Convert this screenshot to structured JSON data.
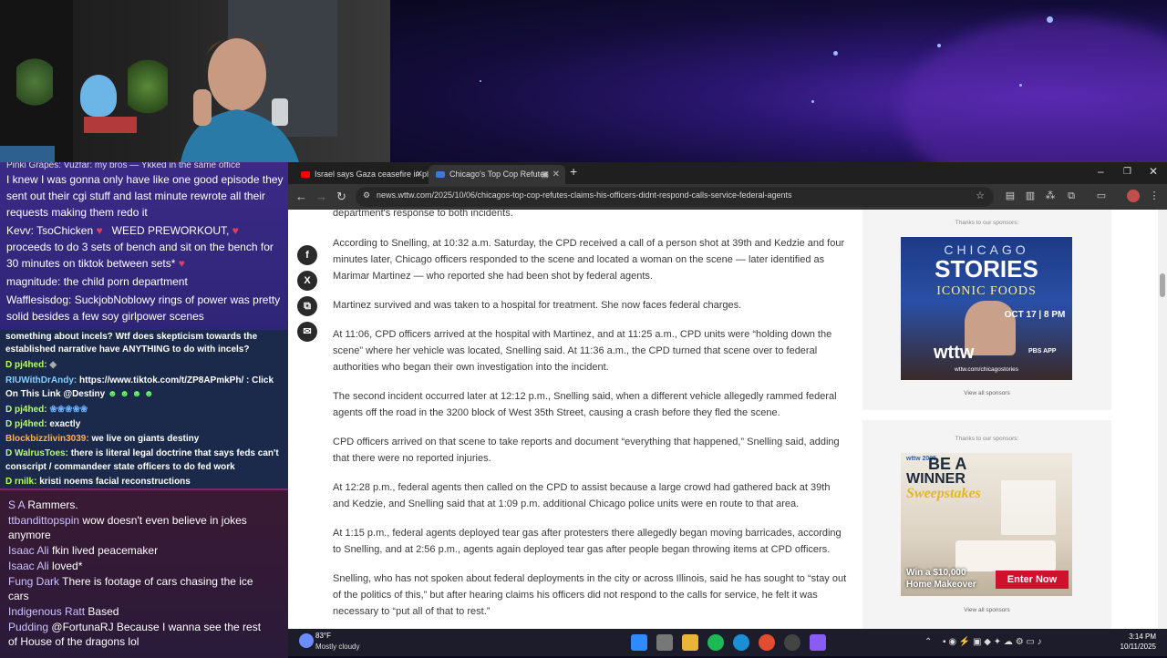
{
  "chat_top": {
    "lines": [
      {
        "text": "I knew I was gonna only have like one good episode they"
      },
      {
        "text": "sent out their cgi stuff and last minute rewrote all their"
      },
      {
        "text": "requests making them redo it"
      },
      {
        "user": "Kevv: TsoChicken",
        "text": "WEED PREWORKOUT,"
      },
      {
        "text": "proceeds to do 3 sets of bench and sit on the bench for"
      },
      {
        "text": "30 minutes on tiktok between sets*"
      },
      {
        "user": "magnitude:",
        "text": "the child porn department"
      },
      {
        "user": "Wafflesisdog:",
        "text": "SuckjobNoblowy rings of power was pretty"
      },
      {
        "text": "solid besides a few soy girlpower scenes"
      }
    ]
  },
  "chat_mid": {
    "lines": [
      {
        "text": "something about incels? Wtf does skepticism towards the"
      },
      {
        "text": "established narrative have ANYTHING to do with incels?"
      },
      {
        "user": "D pj4hed:",
        "text": ""
      },
      {
        "user": "RIUWithDrAndy:",
        "text": "https://www.tiktok.com/t/ZP8APmkPh/ : Click"
      },
      {
        "text": "On This Link @Destiny"
      },
      {
        "user": "D pj4hed:",
        "text": ""
      },
      {
        "user": "D pj4hed:",
        "text": "exactly"
      },
      {
        "user": "Blockbizzlivin3039:",
        "text": "we live on giants destiny"
      },
      {
        "user": "D WalrusToes:",
        "text": "there is literal legal doctrine that says feds can't"
      },
      {
        "text": "conscript / commandeer state officers to do fed work"
      },
      {
        "user": "D rnilk:",
        "text": "kristi noems facial reconstructions"
      }
    ]
  },
  "chat_bottom": {
    "lines": [
      {
        "user": "S A",
        "text": "Rammers."
      },
      {
        "user": "ttbandittopspin",
        "text": "wow doesn't even believe in jokes"
      },
      {
        "text": "anymore"
      },
      {
        "user": "Isaac Ali",
        "text": "fkin lived peacemaker"
      },
      {
        "user": "Isaac Ali",
        "text": "loved*"
      },
      {
        "user": "Fung Dark",
        "text": "There is footage of cars chasing the ice"
      },
      {
        "text": "cars"
      },
      {
        "user": "Indigenous Ratt",
        "text": "Based"
      },
      {
        "user": "Pudding",
        "text": "@FortunaRJ Because I wanna see the rest"
      },
      {
        "text": "of House of the dragons lol"
      }
    ]
  },
  "browser": {
    "tabs": [
      {
        "title": "Israel says Gaza ceasefire in pla",
        "icon": "youtube-icon"
      },
      {
        "title": "Chicago's Top Cop Refutes",
        "icon": "wttw-icon"
      }
    ],
    "url": "news.wttw.com/2025/10/06/chicagos-top-cop-refutes-claims-his-officers-didnt-respond-calls-service-federal-agents"
  },
  "article": {
    "paragraphs": [
      "department's response to both incidents.",
      "According to Snelling, at 10:32 a.m. Saturday, the CPD received a call of a person shot at 39th and Kedzie and four minutes later, Chicago officers responded to the scene and located a woman on the scene — later identified as Marimar Martinez — who reported she had been shot by federal agents.",
      "Martinez survived and was taken to a hospital for treatment. She now faces federal charges.",
      "At 11:06, CPD officers arrived at the hospital with Martinez, and at 11:25 a.m., CPD units were “holding down the scene” where her vehicle was located, Snelling said. At 11:36 a.m., the CPD turned that scene over to federal authorities who began their own investigation into the incident.",
      "The second incident occurred later at 12:12 p.m., Snelling said, when a different vehicle allegedly rammed federal agents off the road in the 3200 block of West 35th Street, causing a crash before they fled the scene.",
      "CPD officers arrived on that scene to take reports and document “everything that happened,” Snelling said, adding that there were no reported injuries.",
      "At 12:28 p.m., federal agents then called on the CPD to assist because a large crowd had gathered back at 39th and Kedzie, and Snelling said that at 1:09 p.m. additional Chicago police units were en route to that area.",
      "At 1:15 p.m., federal agents deployed tear gas after protesters there allegedly began moving barricades, according to Snelling, and at 2:56 p.m., agents again deployed tear gas after people began throwing items at CPD officers.",
      "Snelling, who has not spoken about federal deployments in the city or across Illinois, said he has sought to “stay out of the politics of this,” but after hearing claims his officers did not respond to the calls for service, he felt it was necessary to “put all of that to rest.”"
    ],
    "share": [
      "f",
      "X",
      "⧉",
      "✉"
    ]
  },
  "sponsors": {
    "thanks": "Thanks to our sponsors:",
    "view_all": "View all sponsors",
    "ad1": {
      "line1": "CHICAGO",
      "line2": "STORIES",
      "line3": "ICONIC FOODS",
      "date": "OCT 17 | 8 PM",
      "brand": "wttw",
      "app": "PBS APP",
      "url": "wttw.com/chicagostories"
    },
    "ad2": {
      "brand": "wttw 2025",
      "line1": "BE A",
      "line2": "WINNER",
      "line3": "Sweepstakes",
      "prize1": "Win a $10,000",
      "prize2": "Home Makeover",
      "cta": "Enter Now"
    }
  },
  "taskbar": {
    "weather_temp": "83°F",
    "weather_desc": "Mostly cloudy",
    "time": "3:14 PM",
    "date": "10/11/2025"
  },
  "colors": {
    "chat_top_bg": "#3b2a86",
    "chat_mid_bg": "#1b2a4a",
    "chat_bottom_bg": "#2a1a3a",
    "enter_now": "#d0112b"
  }
}
